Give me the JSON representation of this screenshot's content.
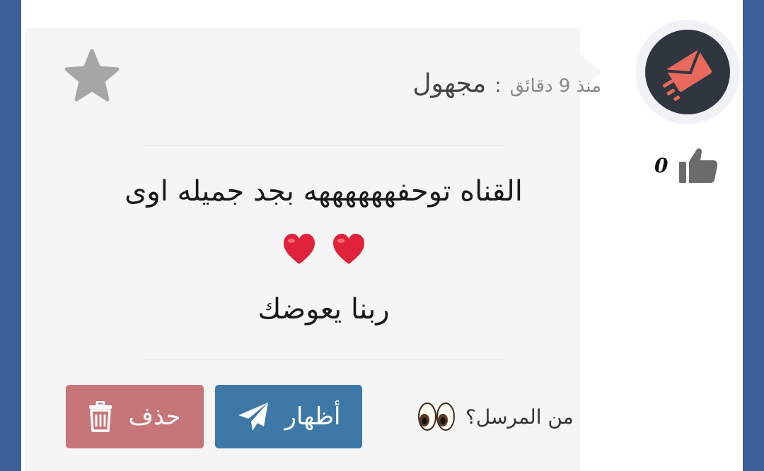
{
  "message": {
    "sender_name": "مجهول",
    "separator": ":",
    "time_ago": "منذ 9 دقائق",
    "text_line1": "القناه توحفههههههه بجد جميله اوى",
    "hearts": [
      "❤️",
      "❤️"
    ],
    "text_line3": "ربنا يعوضك"
  },
  "actions": {
    "who_sent_label": "من المرسل؟",
    "who_sent_icon": "eyes-icon",
    "show_label": "أظهار",
    "show_icon": "paper-plane-icon",
    "delete_label": "حذف",
    "delete_icon": "trash-icon",
    "favorite_icon": "star-icon"
  },
  "sidebar": {
    "likes_count": "0",
    "like_icon": "thumbs-up-icon",
    "avatar_icon": "envelope-icon"
  },
  "colors": {
    "frame": "#3d5f9a",
    "card": "#f5f5f5",
    "show_button": "#3d78a6",
    "delete_button": "#c06468",
    "avatar_bg": "#2f3640",
    "avatar_envelope": "#e86a5c"
  }
}
